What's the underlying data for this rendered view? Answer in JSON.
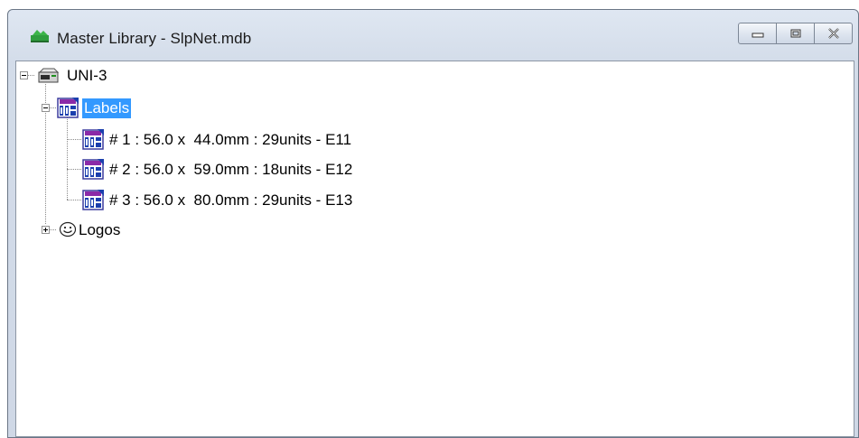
{
  "window": {
    "title": "Master Library - SlpNet.mdb",
    "controls": [
      "minimize",
      "restore",
      "close"
    ]
  },
  "tree": {
    "root": {
      "label": "UNI-3",
      "icon": "database-drive-icon",
      "expanded": true
    },
    "labels_folder": {
      "label": "Labels",
      "icon": "label-layout-icon",
      "expanded": true,
      "selected": true
    },
    "label_items": [
      {
        "label": "# 1 : 56.0 x  44.0mm : 29units - E11",
        "icon": "label-layout-icon"
      },
      {
        "label": "# 2 : 56.0 x  59.0mm : 18units - E12",
        "icon": "label-layout-icon"
      },
      {
        "label": "# 3 : 56.0 x  80.0mm : 29units - E13",
        "icon": "label-layout-icon"
      }
    ],
    "logos_folder": {
      "label": "Logos",
      "icon": "smiley-face-icon",
      "expanded": false
    }
  },
  "colors": {
    "selection": "#3399ff",
    "frame": "#d3dce9"
  }
}
